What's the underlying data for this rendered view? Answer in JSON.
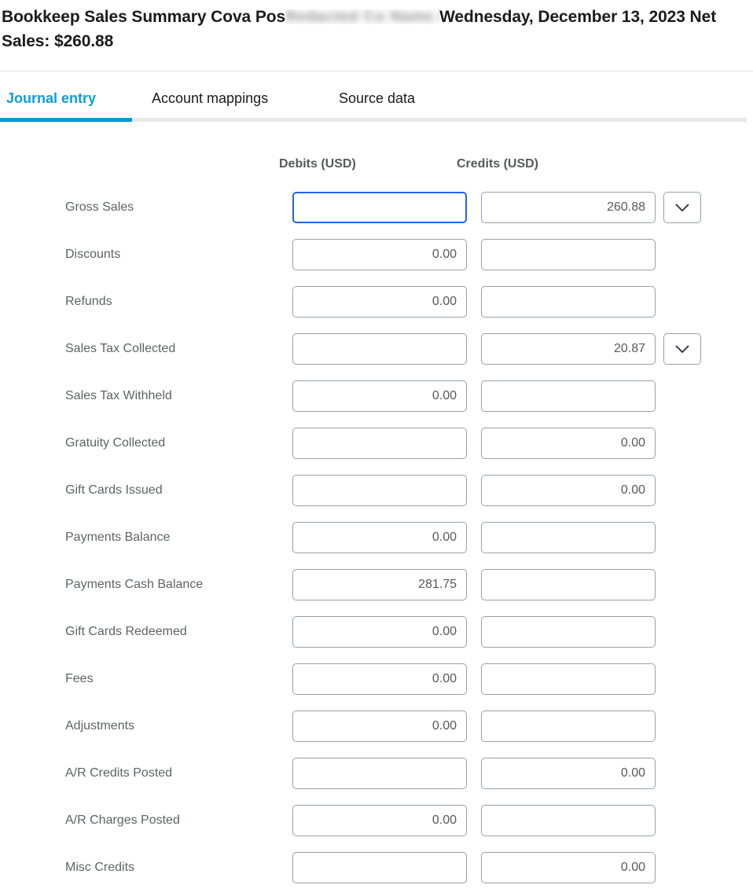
{
  "header": {
    "title_prefix": "Bookkeep Sales Summary Cova Pos",
    "redacted_text": "Redacted Co Name Ab",
    "title_suffix": "Wednesday, December 13, 2023 Net Sales: $260.88",
    "accent_color": "#009ad8"
  },
  "tabs": [
    {
      "label": "Journal entry",
      "active": true
    },
    {
      "label": "Account mappings",
      "active": false
    },
    {
      "label": "Source data",
      "active": false
    }
  ],
  "table": {
    "columns": {
      "label": "",
      "debits": "Debits (USD)",
      "credits": "Credits (USD)"
    },
    "rows": [
      {
        "label": "Gross Sales",
        "debit": "",
        "credit": "260.88",
        "debit_visible": true,
        "credit_visible": true,
        "debit_focused": true,
        "chevron": true
      },
      {
        "label": "Discounts",
        "debit": "0.00",
        "credit": "",
        "debit_visible": true,
        "credit_visible": true,
        "debit_focused": false,
        "chevron": false
      },
      {
        "label": "Refunds",
        "debit": "0.00",
        "credit": "",
        "debit_visible": true,
        "credit_visible": true,
        "debit_focused": false,
        "chevron": false
      },
      {
        "label": "Sales Tax Collected",
        "debit": "",
        "credit": "20.87",
        "debit_visible": true,
        "credit_visible": true,
        "debit_focused": false,
        "chevron": true
      },
      {
        "label": "Sales Tax Withheld",
        "debit": "0.00",
        "credit": "",
        "debit_visible": true,
        "credit_visible": true,
        "debit_focused": false,
        "chevron": false
      },
      {
        "label": "Gratuity Collected",
        "debit": "",
        "credit": "0.00",
        "debit_visible": true,
        "credit_visible": true,
        "debit_focused": false,
        "chevron": false
      },
      {
        "label": "Gift Cards Issued",
        "debit": "",
        "credit": "0.00",
        "debit_visible": true,
        "credit_visible": true,
        "debit_focused": false,
        "chevron": false
      },
      {
        "label": "Payments Balance",
        "debit": "0.00",
        "credit": "",
        "debit_visible": true,
        "credit_visible": true,
        "debit_focused": false,
        "chevron": false
      },
      {
        "label": "Payments Cash Balance",
        "debit": "281.75",
        "credit": "",
        "debit_visible": true,
        "credit_visible": true,
        "debit_focused": false,
        "chevron": false
      },
      {
        "label": "Gift Cards Redeemed",
        "debit": "0.00",
        "credit": "",
        "debit_visible": true,
        "credit_visible": true,
        "debit_focused": false,
        "chevron": false
      },
      {
        "label": "Fees",
        "debit": "0.00",
        "credit": "",
        "debit_visible": true,
        "credit_visible": true,
        "debit_focused": false,
        "chevron": false
      },
      {
        "label": "Adjustments",
        "debit": "0.00",
        "credit": "",
        "debit_visible": true,
        "credit_visible": true,
        "debit_focused": false,
        "chevron": false
      },
      {
        "label": "A/R Credits Posted",
        "debit": "",
        "credit": "0.00",
        "debit_visible": true,
        "credit_visible": true,
        "debit_focused": false,
        "chevron": false
      },
      {
        "label": "A/R Charges Posted",
        "debit": "0.00",
        "credit": "",
        "debit_visible": true,
        "credit_visible": true,
        "debit_focused": false,
        "chevron": false
      },
      {
        "label": "Misc Credits",
        "debit": "",
        "credit": "0.00",
        "debit_visible": true,
        "credit_visible": true,
        "debit_focused": false,
        "chevron": false
      }
    ]
  },
  "icons": {
    "chevron_down": "chevron-down-icon"
  }
}
